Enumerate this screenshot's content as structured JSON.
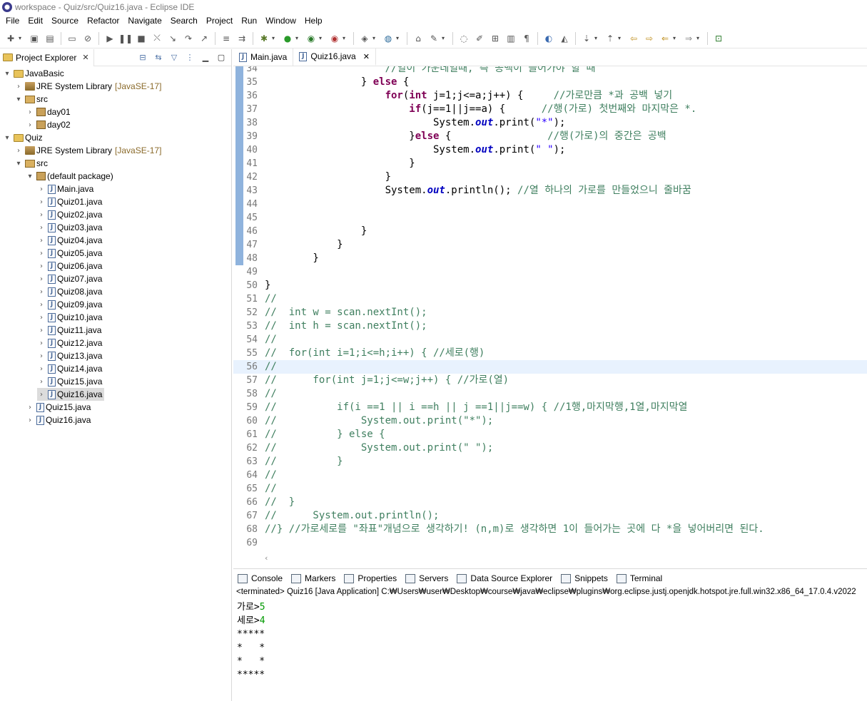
{
  "window": {
    "title": "workspace - Quiz/src/Quiz16.java - Eclipse IDE"
  },
  "menu": [
    "File",
    "Edit",
    "Source",
    "Refactor",
    "Navigate",
    "Search",
    "Project",
    "Run",
    "Window",
    "Help"
  ],
  "project_explorer": {
    "tab_label": "Project Explorer",
    "close_glyph": "✕",
    "tree": [
      {
        "label": "JavaBasic",
        "depth": 0,
        "twisty": "⌄",
        "icon": "project-icon"
      },
      {
        "label": "JRE System Library",
        "suffix": "[JavaSE-17]",
        "depth": 1,
        "twisty": "›",
        "icon": "library-icon"
      },
      {
        "label": "src",
        "depth": 1,
        "twisty": "⌄",
        "icon": "source-folder-icon"
      },
      {
        "label": "day01",
        "depth": 2,
        "twisty": "›",
        "icon": "package-icon"
      },
      {
        "label": "day02",
        "depth": 2,
        "twisty": "›",
        "icon": "package-icon"
      },
      {
        "label": "Quiz",
        "depth": 0,
        "twisty": "⌄",
        "icon": "project-icon"
      },
      {
        "label": "JRE System Library",
        "suffix": "[JavaSE-17]",
        "depth": 1,
        "twisty": "›",
        "icon": "library-icon"
      },
      {
        "label": "src",
        "depth": 1,
        "twisty": "⌄",
        "icon": "source-folder-icon"
      },
      {
        "label": "(default package)",
        "depth": 2,
        "twisty": "⌄",
        "icon": "package-icon"
      },
      {
        "label": "Main.java",
        "depth": 3,
        "twisty": "›",
        "icon": "java-file-icon"
      },
      {
        "label": "Quiz01.java",
        "depth": 3,
        "twisty": "›",
        "icon": "java-file-icon"
      },
      {
        "label": "Quiz02.java",
        "depth": 3,
        "twisty": "›",
        "icon": "java-file-icon"
      },
      {
        "label": "Quiz03.java",
        "depth": 3,
        "twisty": "›",
        "icon": "java-file-icon"
      },
      {
        "label": "Quiz04.java",
        "depth": 3,
        "twisty": "›",
        "icon": "java-file-icon"
      },
      {
        "label": "Quiz05.java",
        "depth": 3,
        "twisty": "›",
        "icon": "java-file-icon"
      },
      {
        "label": "Quiz06.java",
        "depth": 3,
        "twisty": "›",
        "icon": "java-file-icon"
      },
      {
        "label": "Quiz07.java",
        "depth": 3,
        "twisty": "›",
        "icon": "java-file-icon"
      },
      {
        "label": "Quiz08.java",
        "depth": 3,
        "twisty": "›",
        "icon": "java-file-icon"
      },
      {
        "label": "Quiz09.java",
        "depth": 3,
        "twisty": "›",
        "icon": "java-file-icon"
      },
      {
        "label": "Quiz10.java",
        "depth": 3,
        "twisty": "›",
        "icon": "java-file-icon"
      },
      {
        "label": "Quiz11.java",
        "depth": 3,
        "twisty": "›",
        "icon": "java-file-icon"
      },
      {
        "label": "Quiz12.java",
        "depth": 3,
        "twisty": "›",
        "icon": "java-file-icon"
      },
      {
        "label": "Quiz13.java",
        "depth": 3,
        "twisty": "›",
        "icon": "java-file-icon"
      },
      {
        "label": "Quiz14.java",
        "depth": 3,
        "twisty": "›",
        "icon": "java-file-icon"
      },
      {
        "label": "Quiz15.java",
        "depth": 3,
        "twisty": "›",
        "icon": "java-file-icon"
      },
      {
        "label": "Quiz16.java",
        "depth": 3,
        "twisty": "›",
        "icon": "java-file-icon",
        "selected": true
      },
      {
        "label": "Quiz15.java",
        "depth": 2,
        "twisty": "›",
        "icon": "java-file-icon"
      },
      {
        "label": "Quiz16.java",
        "depth": 2,
        "twisty": "›",
        "icon": "java-file-icon"
      }
    ]
  },
  "editor": {
    "tabs": [
      {
        "label": "Main.java",
        "active": false
      },
      {
        "label": "Quiz16.java",
        "active": true
      }
    ],
    "close_glyph": "✕",
    "current_line": 56,
    "scroll_left_glyph": "‹",
    "lines": [
      {
        "n": "34",
        "marked": true,
        "tokens": [
          [
            "",
            "                    "
          ],
          [
            "cm",
            "//열이 가운데일때, 즉 공백이 들어가야 할 때"
          ]
        ]
      },
      {
        "n": "35",
        "marked": true,
        "tokens": [
          [
            "",
            "                } "
          ],
          [
            "kw",
            "else"
          ],
          [
            "",
            " {"
          ]
        ]
      },
      {
        "n": "36",
        "marked": true,
        "tokens": [
          [
            "",
            "                    "
          ],
          [
            "kw",
            "for"
          ],
          [
            "",
            "("
          ],
          [
            "kw",
            "int"
          ],
          [
            "",
            " j=1;j<=a;j++) {     "
          ],
          [
            "cm",
            "//가로만큼 *과 공백 넣기"
          ]
        ]
      },
      {
        "n": "37",
        "marked": true,
        "tokens": [
          [
            "",
            "                        "
          ],
          [
            "kw",
            "if"
          ],
          [
            "",
            "(j==1||j==a) {      "
          ],
          [
            "cm",
            "//행(가로) 첫번째와 마지막은 *."
          ]
        ]
      },
      {
        "n": "38",
        "marked": true,
        "tokens": [
          [
            "",
            "                            System."
          ],
          [
            "sf",
            "out"
          ],
          [
            "",
            ".print("
          ],
          [
            "st",
            "\"*\""
          ],
          [
            "",
            ");"
          ]
        ]
      },
      {
        "n": "39",
        "marked": true,
        "tokens": [
          [
            "",
            "                        }"
          ],
          [
            "kw",
            "else"
          ],
          [
            "",
            " {                "
          ],
          [
            "cm",
            "//행(가로)의 중간은 공백"
          ]
        ]
      },
      {
        "n": "40",
        "marked": true,
        "tokens": [
          [
            "",
            "                            System."
          ],
          [
            "sf",
            "out"
          ],
          [
            "",
            ".print("
          ],
          [
            "st",
            "\" \""
          ],
          [
            "",
            ");"
          ]
        ]
      },
      {
        "n": "41",
        "marked": true,
        "tokens": [
          [
            "",
            "                        }"
          ]
        ]
      },
      {
        "n": "42",
        "marked": true,
        "tokens": [
          [
            "",
            "                    }"
          ]
        ]
      },
      {
        "n": "43",
        "marked": true,
        "tokens": [
          [
            "",
            "                    System."
          ],
          [
            "sf",
            "out"
          ],
          [
            "",
            ".println(); "
          ],
          [
            "cm",
            "//열 하나의 가로를 만들었으니 줄바꿈"
          ]
        ]
      },
      {
        "n": "44",
        "marked": true,
        "tokens": [
          [
            "",
            ""
          ]
        ]
      },
      {
        "n": "45",
        "marked": true,
        "tokens": [
          [
            "",
            ""
          ]
        ]
      },
      {
        "n": "46",
        "marked": true,
        "tokens": [
          [
            "",
            "                }"
          ]
        ]
      },
      {
        "n": "47",
        "marked": true,
        "tokens": [
          [
            "",
            "            }"
          ]
        ]
      },
      {
        "n": "48",
        "marked": true,
        "tokens": [
          [
            "",
            "        }"
          ]
        ]
      },
      {
        "n": "49",
        "marked": false,
        "tokens": [
          [
            "",
            ""
          ]
        ]
      },
      {
        "n": "50",
        "marked": false,
        "tokens": [
          [
            "",
            "}"
          ]
        ]
      },
      {
        "n": "51",
        "marked": false,
        "tokens": [
          [
            "cm",
            "//"
          ]
        ]
      },
      {
        "n": "52",
        "marked": false,
        "tokens": [
          [
            "cm",
            "//  int w = scan.nextInt();"
          ]
        ]
      },
      {
        "n": "53",
        "marked": false,
        "tokens": [
          [
            "cm",
            "//  int h = scan.nextInt();"
          ]
        ]
      },
      {
        "n": "54",
        "marked": false,
        "tokens": [
          [
            "cm",
            "//"
          ]
        ]
      },
      {
        "n": "55",
        "marked": false,
        "tokens": [
          [
            "cm",
            "//  for(int i=1;i<=h;i++) { //세로(행)"
          ]
        ]
      },
      {
        "n": "56",
        "marked": false,
        "tokens": [
          [
            "cm",
            "//"
          ]
        ]
      },
      {
        "n": "57",
        "marked": false,
        "tokens": [
          [
            "cm",
            "//      for(int j=1;j<=w;j++) { //가로(열)"
          ]
        ]
      },
      {
        "n": "58",
        "marked": false,
        "tokens": [
          [
            "cm",
            "//"
          ]
        ]
      },
      {
        "n": "59",
        "marked": false,
        "tokens": [
          [
            "cm",
            "//          if(i ==1 || i ==h || j ==1||j==w) { //1행,마지막행,1열,마지막열"
          ]
        ]
      },
      {
        "n": "60",
        "marked": false,
        "tokens": [
          [
            "cm",
            "//              System.out.print(\"*\");"
          ]
        ]
      },
      {
        "n": "61",
        "marked": false,
        "tokens": [
          [
            "cm",
            "//          } else {"
          ]
        ]
      },
      {
        "n": "62",
        "marked": false,
        "tokens": [
          [
            "cm",
            "//              System.out.print(\" \");"
          ]
        ]
      },
      {
        "n": "63",
        "marked": false,
        "tokens": [
          [
            "cm",
            "//          }"
          ]
        ]
      },
      {
        "n": "64",
        "marked": false,
        "tokens": [
          [
            "cm",
            "//"
          ]
        ]
      },
      {
        "n": "65",
        "marked": false,
        "tokens": [
          [
            "cm",
            "//"
          ]
        ]
      },
      {
        "n": "66",
        "marked": false,
        "tokens": [
          [
            "cm",
            "//  }"
          ]
        ]
      },
      {
        "n": "67",
        "marked": false,
        "tokens": [
          [
            "cm",
            "//      System.out.println();"
          ]
        ]
      },
      {
        "n": "68",
        "marked": false,
        "tokens": [
          [
            "cm",
            "//} //가로세로를 \"좌표\"개념으로 생각하기! (n,m)로 생각하면 1이 들어가는 곳에 다 *을 넣어버리면 된다."
          ]
        ]
      },
      {
        "n": "69",
        "marked": false,
        "tokens": [
          [
            "",
            ""
          ]
        ]
      }
    ]
  },
  "console": {
    "tabs": [
      {
        "label": "Console",
        "active": true
      },
      {
        "label": "Markers",
        "active": false
      },
      {
        "label": "Properties",
        "active": false
      },
      {
        "label": "Servers",
        "active": false
      },
      {
        "label": "Data Source Explorer",
        "active": false
      },
      {
        "label": "Snippets",
        "active": false
      },
      {
        "label": "Terminal",
        "active": false
      }
    ],
    "status": "<terminated> Quiz16 [Java Application] C:₩Users₩user₩Desktop₩course₩java₩eclipse₩plugins₩org.eclipse.justj.openjdk.hotspot.jre.full.win32.x86_64_17.0.4.v2022",
    "output": [
      {
        "prompt": "가로>",
        "input": "5"
      },
      {
        "prompt": "세로>",
        "input": "4"
      },
      {
        "prompt": "*****",
        "input": ""
      },
      {
        "prompt": "*   *",
        "input": ""
      },
      {
        "prompt": "*   *",
        "input": ""
      },
      {
        "prompt": "*****",
        "input": ""
      }
    ]
  },
  "colors": {
    "keyword": "#7f0055",
    "comment": "#3f7f5f",
    "string": "#2a00ff",
    "static_field": "#0000c0",
    "current_line": "#e8f2fe",
    "console_input": "#009900",
    "quick_diff_marker": "#8fb3dd"
  }
}
